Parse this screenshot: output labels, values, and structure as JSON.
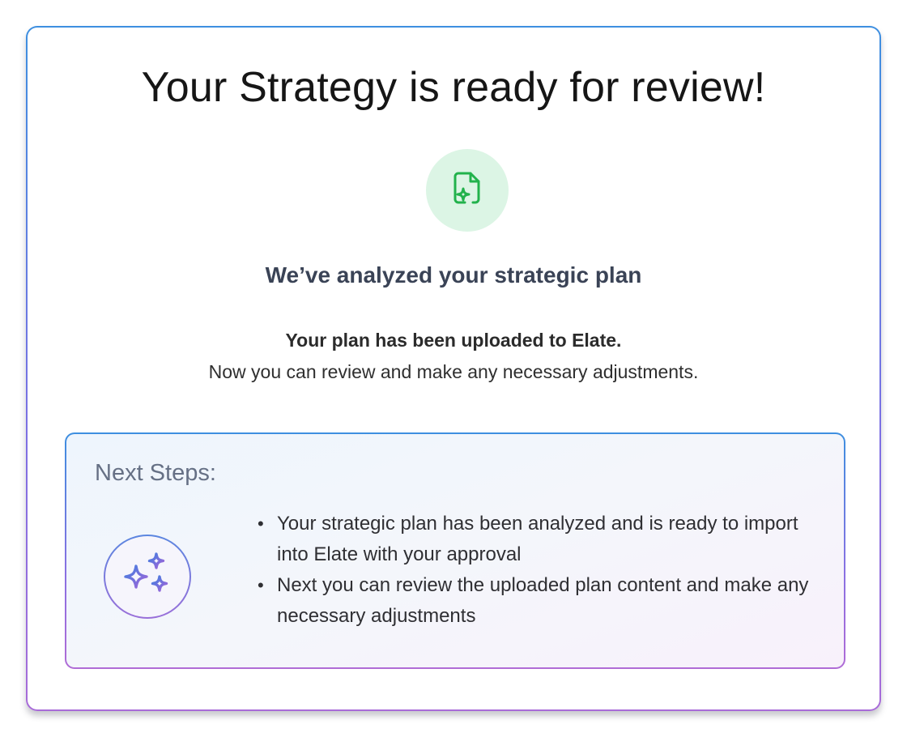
{
  "header": {
    "title": "Your Strategy is ready for review!"
  },
  "status_icon": {
    "name": "document-sparkle-icon",
    "color": "#22b24c",
    "background": "#dcf5e5"
  },
  "summary": {
    "subtitle": "We’ve analyzed your strategic plan",
    "upload_message": "Your plan has been uploaded to Elate.",
    "review_message": "Now you can review and make any necessary adjustments."
  },
  "next_steps": {
    "heading": "Next Steps:",
    "icon": "sparkles-icon",
    "items": [
      {
        "text": "Your strategic plan has been analyzed and is ready to import into Elate with your approval"
      },
      {
        "text": "Next you can review the uploaded plan content and make any necessary adjustments"
      }
    ]
  },
  "colors": {
    "accent_blue": "#3d8fe0",
    "accent_purple": "#a86bd8",
    "success_green": "#22b24c"
  }
}
